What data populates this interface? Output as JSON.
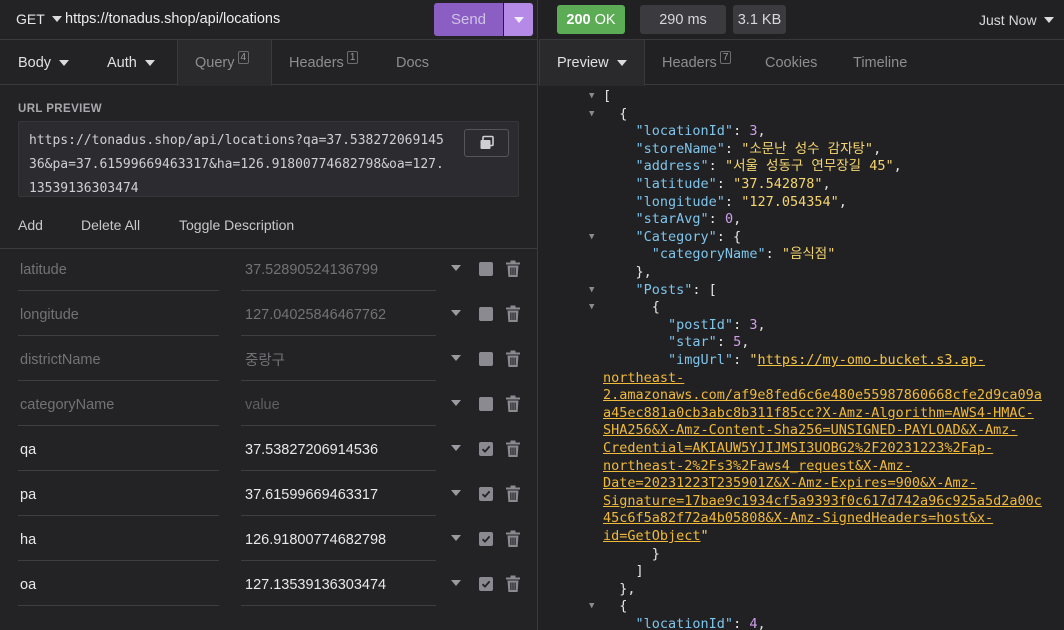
{
  "request": {
    "method": "GET",
    "url": "https://tonadus.shop/api/locations",
    "send_label": "Send",
    "tabs": [
      {
        "label": "Body",
        "dropdown": true
      },
      {
        "label": "Auth",
        "dropdown": true
      },
      {
        "label": "Query",
        "count": "4",
        "active": true
      },
      {
        "label": "Headers",
        "count": "1"
      },
      {
        "label": "Docs"
      }
    ],
    "url_preview_label": "URL PREVIEW",
    "url_preview": "https://tonadus.shop/api/locations?qa=37.53827206914536&pa=37.61599669463317&ha=126.91800774682798&oa=127.13539136303474",
    "actions": {
      "add": "Add",
      "delete_all": "Delete All",
      "toggle_description": "Toggle Description"
    },
    "params": [
      {
        "name": "latitude",
        "value": "37.52890524136799",
        "enabled": false
      },
      {
        "name": "longitude",
        "value": "127.04025846467762",
        "enabled": false
      },
      {
        "name": "districtName",
        "value": "중랑구",
        "enabled": false
      },
      {
        "name": "categoryName",
        "value": "",
        "placeholder": "value",
        "enabled": false
      },
      {
        "name": "qa",
        "value": "37.53827206914536",
        "enabled": true
      },
      {
        "name": "pa",
        "value": "37.61599669463317",
        "enabled": true
      },
      {
        "name": "ha",
        "value": "126.91800774682798",
        "enabled": true
      },
      {
        "name": "oa",
        "value": "127.13539136303474",
        "enabled": true
      }
    ]
  },
  "response": {
    "status_code": "200",
    "status_text": "OK",
    "time": "290 ms",
    "size": "3.1 KB",
    "when": "Just Now",
    "tabs": [
      {
        "label": "Preview",
        "dropdown": true,
        "active": true
      },
      {
        "label": "Headers",
        "count": "7"
      },
      {
        "label": "Cookies"
      },
      {
        "label": "Timeline"
      }
    ],
    "body": {
      "first_location": {
        "locationId": "3",
        "storeName": "소문난 성수 감자탕",
        "address": "서울 성동구 연무장길 45",
        "latitude": "37.542878",
        "longitude": "127.054354",
        "starAvg": "0",
        "categoryName": "음식점",
        "post": {
          "postId": "3",
          "star": "5",
          "imgUrl": "https://my-omo-bucket.s3.ap-northeast-2.amazonaws.com/af9e8fed6c6e480e55987860668cfe2d9ca09aa45ec881a0cb3abc8b311f85cc?X-Amz-Algorithm=AWS4-HMAC-SHA256&X-Amz-Content-Sha256=UNSIGNED-PAYLOAD&X-Amz-Credential=AKIAUW5YJIJMSI3UOBG2%2F20231223%2Fap-northeast-2%2Fs3%2Faws4_request&X-Amz-Date=20231223T235901Z&X-Amz-Expires=900&X-Amz-Signature=17bae9c1934cf5a9393f0c617d742a96c925a5d2a00c45c6f5a82f72a4b05808&X-Amz-SignedHeaders=host&x-id=GetObject"
        }
      },
      "second_location": {
        "locationId": "4"
      }
    },
    "img_url_lines": [
      "northeast-",
      "2.amazonaws.com/af9e8fed6c6e480e55987860668cfe2d9ca09a",
      "a45ec881a0cb3abc8b311f85cc?X-Amz-Algorithm=AWS4-HMAC-",
      "SHA256&X-Amz-Content-Sha256=UNSIGNED-PAYLOAD&X-Amz-",
      "Credential=AKIAUW5YJIJMSI3UOBG2%2F20231223%2Fap-",
      "northeast-2%2Fs3%2Faws4_request&X-Amz-",
      "Date=20231223T235901Z&X-Amz-Expires=900&X-Amz-",
      "Signature=17bae9c1934cf5a9393f0c617d742a96c925a5d2a00c",
      "45c6f5a82f72a4b05808&X-Amz-SignedHeaders=host&x-",
      "id=GetObject"
    ],
    "img_url_first_part": "https://my-omo-bucket.s3.ap-"
  },
  "colors": {
    "accent": "#8a5ec2",
    "send_dropdown": "#b48ae6",
    "status_ok": "#5cab55",
    "json_key": "#7fc4ea",
    "json_string": "#f5d66f",
    "json_number": "#cda0ea"
  }
}
